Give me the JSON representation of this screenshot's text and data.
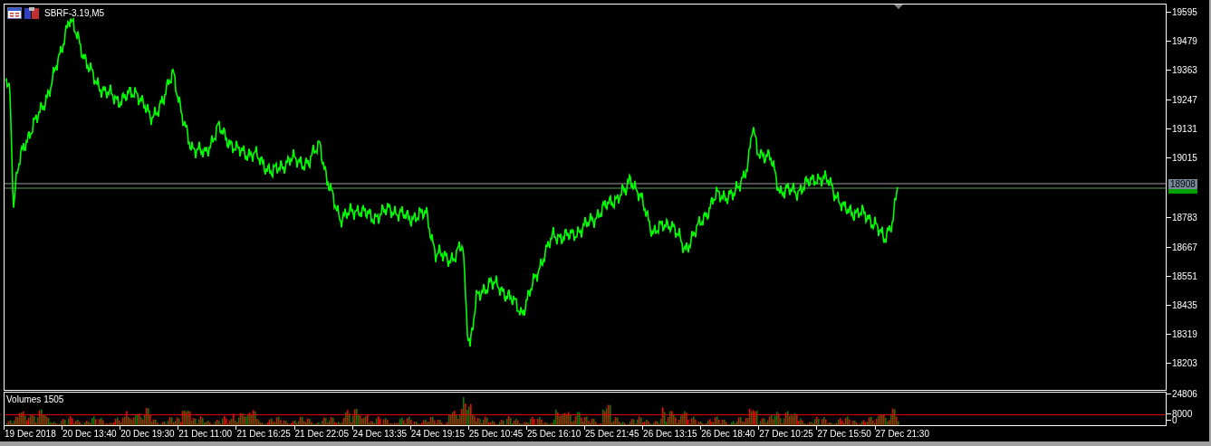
{
  "chart": {
    "title": "SBRF-3.19,M5"
  },
  "price_axis": {
    "labels": [
      "19595",
      "19479",
      "19363",
      "19247",
      "19131",
      "19015",
      "18783",
      "18667",
      "18551",
      "18435",
      "18319",
      "18203"
    ],
    "current_price": "18908"
  },
  "volume_panel": {
    "label": "Volumes 1505",
    "axis_labels": [
      "24806",
      "8000",
      "0"
    ]
  },
  "time_axis": {
    "labels": [
      "19 Dec 2018",
      "20 Dec 13:40",
      "20 Dec 19:30",
      "21 Dec 11:00",
      "21 Dec 16:25",
      "21 Dec 22:05",
      "24 Dec 13:35",
      "24 Dec 19:15",
      "25 Dec 10:45",
      "25 Dec 16:10",
      "25 Dec 21:45",
      "26 Dec 13:15",
      "26 Dec 18:40",
      "27 Dec 10:25",
      "27 Dec 15:50",
      "27 Dec 21:30"
    ]
  }
}
